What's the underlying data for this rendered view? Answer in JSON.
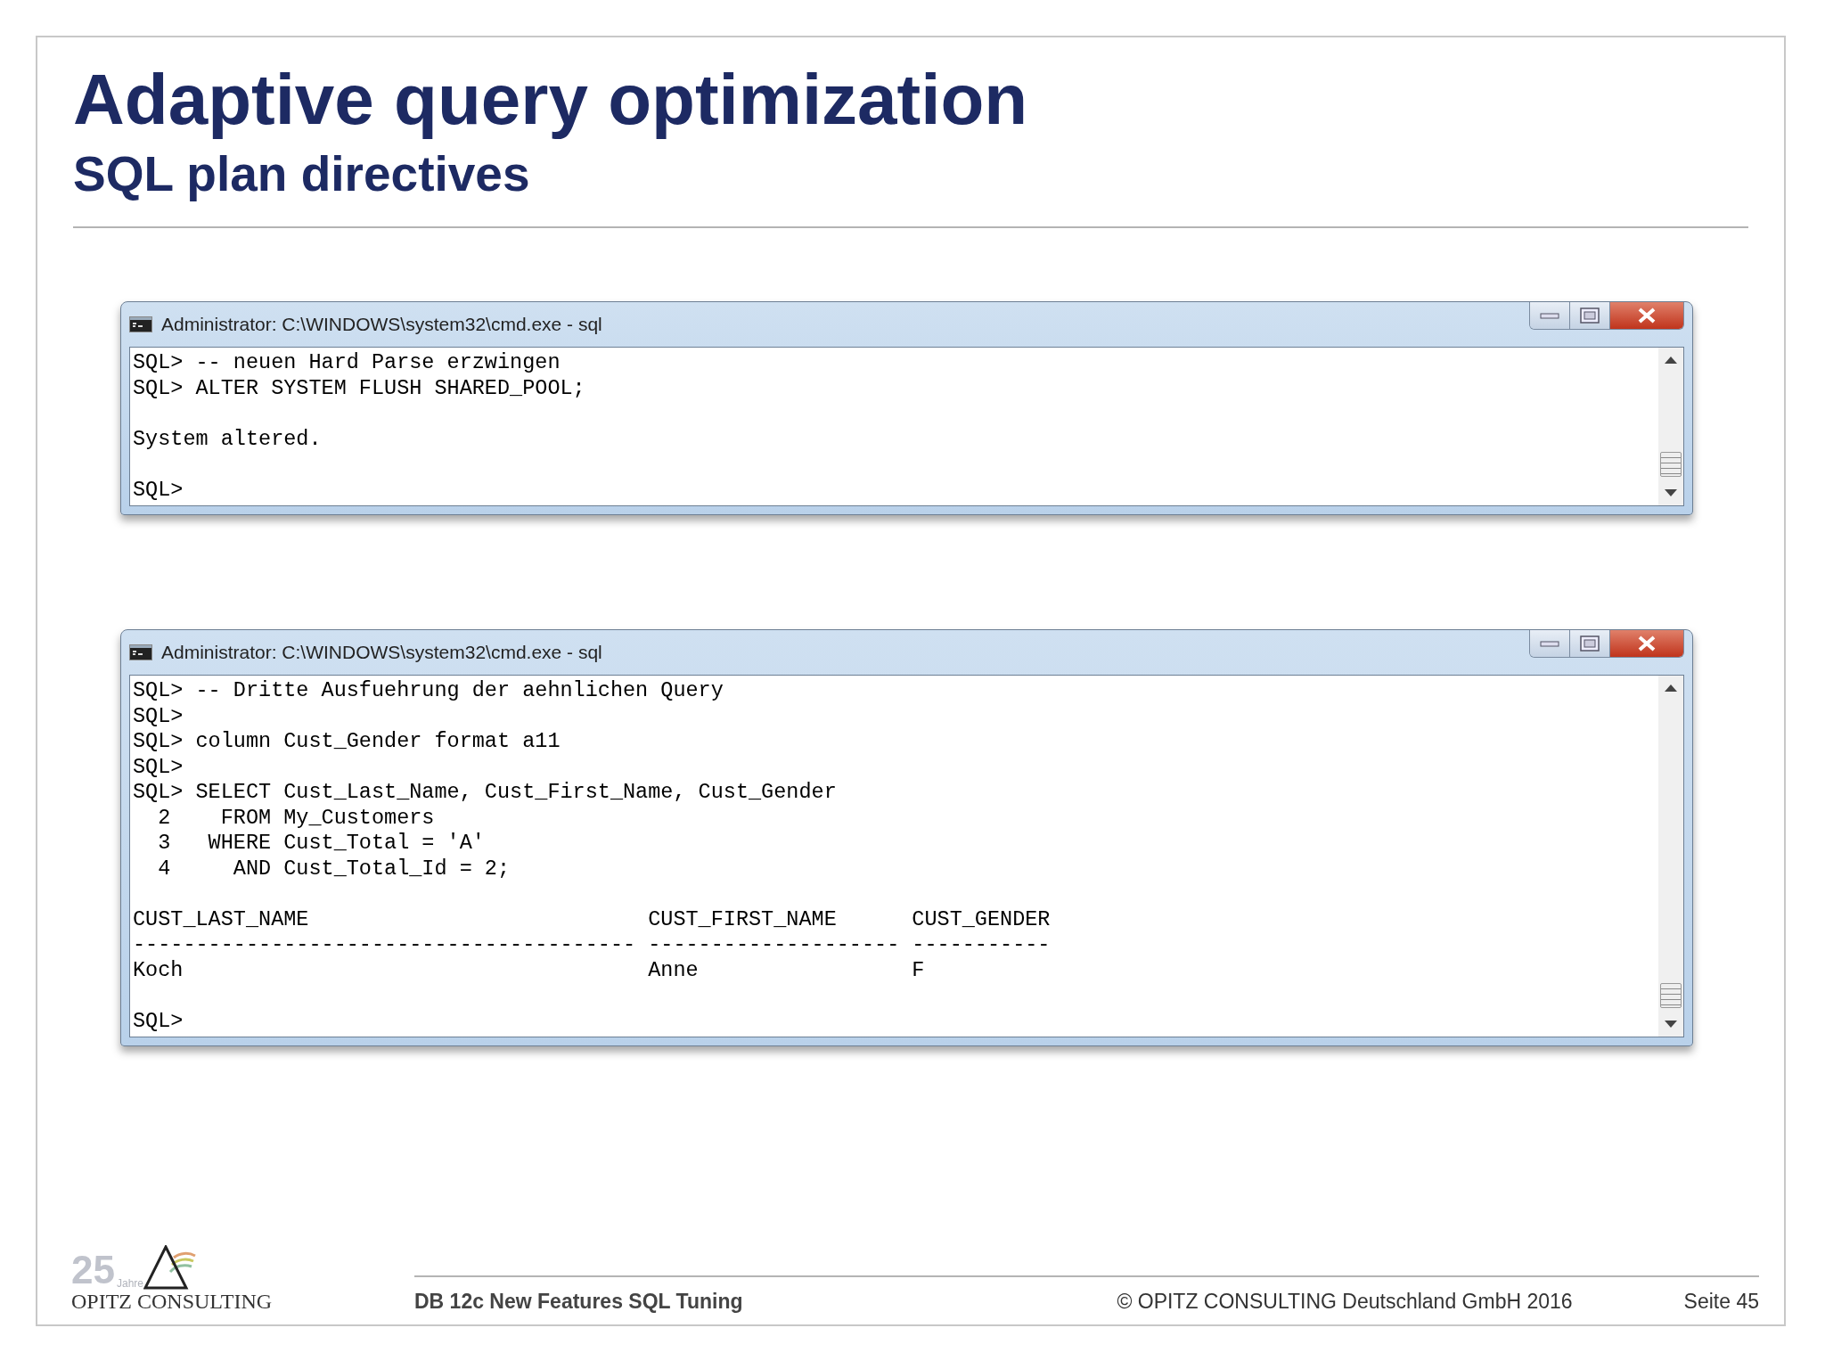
{
  "slide": {
    "title": "Adaptive query optimization",
    "subtitle": "SQL plan directives"
  },
  "windows": [
    {
      "title": "Administrator: C:\\WINDOWS\\system32\\cmd.exe - sql",
      "lines": [
        {
          "kind": "text",
          "text": "SQL> -- neuen Hard Parse erzwingen"
        },
        {
          "kind": "text",
          "text": "SQL> ALTER SYSTEM FLUSH SHARED_POOL;"
        },
        {
          "kind": "blank"
        },
        {
          "kind": "text",
          "text": "System altered."
        },
        {
          "kind": "blank"
        },
        {
          "kind": "text",
          "text": "SQL>"
        }
      ]
    },
    {
      "title": "Administrator: C:\\WINDOWS\\system32\\cmd.exe - sql",
      "lines": [
        {
          "kind": "text",
          "text": "SQL> -- Dritte Ausfuehrung der aehnlichen Query"
        },
        {
          "kind": "text",
          "text": "SQL>"
        },
        {
          "kind": "text",
          "text": "SQL> column Cust_Gender format a11"
        },
        {
          "kind": "text",
          "text": "SQL>"
        },
        {
          "kind": "text",
          "text": "SQL> SELECT Cust_Last_Name, Cust_First_Name, Cust_Gender"
        },
        {
          "kind": "text",
          "text": "  2    FROM My_Customers"
        },
        {
          "kind": "text",
          "text": "  3   WHERE Cust_Total = 'A'"
        },
        {
          "kind": "text",
          "text": "  4     AND Cust_Total_Id = 2;"
        },
        {
          "kind": "blank"
        },
        {
          "kind": "text",
          "text": "CUST_LAST_NAME                           CUST_FIRST_NAME      CUST_GENDER"
        },
        {
          "kind": "text",
          "text": "---------------------------------------- -------------------- -----------"
        },
        {
          "kind": "text",
          "text": "Koch                                     Anne                 F"
        },
        {
          "kind": "blank"
        },
        {
          "kind": "text",
          "text": "SQL>"
        }
      ]
    }
  ],
  "logo": {
    "number": "25",
    "number_caption": "Jahre",
    "name": "OPITZ CONSULTING"
  },
  "footer": {
    "presentation": "DB 12c New Features SQL Tuning",
    "copyright": "© OPITZ CONSULTING Deutschland GmbH 2016",
    "page": "Seite 45"
  }
}
